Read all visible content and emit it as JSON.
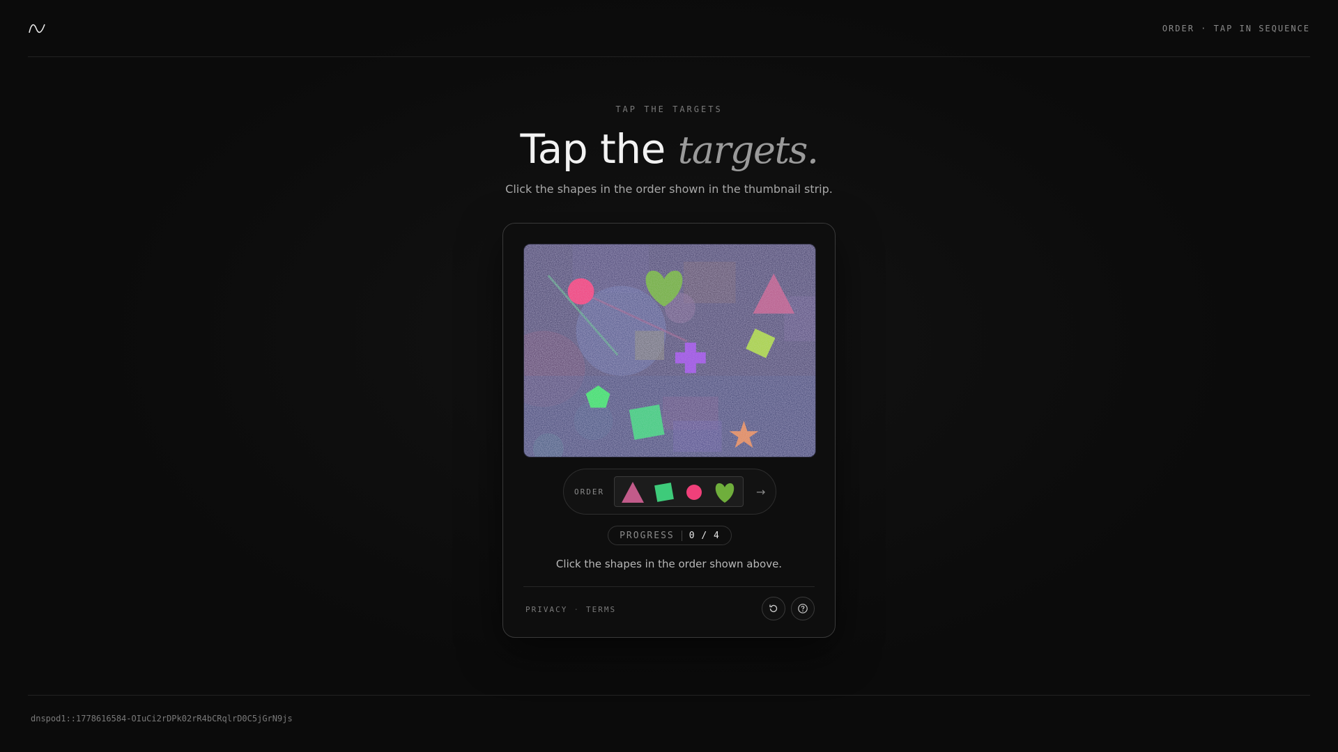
{
  "header": {
    "logo_icon": "wave-logo-icon",
    "right_label": "ORDER · TAP IN SEQUENCE"
  },
  "hero": {
    "eyebrow": "TAP THE TARGETS",
    "headline_plain": "Tap the ",
    "headline_emphasis": "targets.",
    "subtitle": "Click the shapes in the order shown in the thumbnail strip."
  },
  "challenge": {
    "order_label": "ORDER",
    "order_sequence": [
      "triangle",
      "square",
      "circle",
      "heart"
    ],
    "next_icon": "arrow-right-icon",
    "progress_label": "PROGRESS",
    "progress_value": "0 / 4",
    "instruction": "Click the shapes in the order shown above.",
    "colors": {
      "triangle": "#c25b8a",
      "square": "#3ecb7a",
      "circle": "#f0407a",
      "heart": "#6fae3c",
      "cross": "#9a4fe0",
      "diamond": "#a6d244",
      "pentagon": "#3fe06a",
      "star": "#e0885a"
    }
  },
  "footer": {
    "privacy": "PRIVACY",
    "separator": "·",
    "terms": "TERMS",
    "reload_icon": "reload-icon",
    "help_icon": "help-icon",
    "token": "dnspod1::1778616584-OIuCi2rDPk02rR4bCRqlrD0C5jGrN9js"
  }
}
